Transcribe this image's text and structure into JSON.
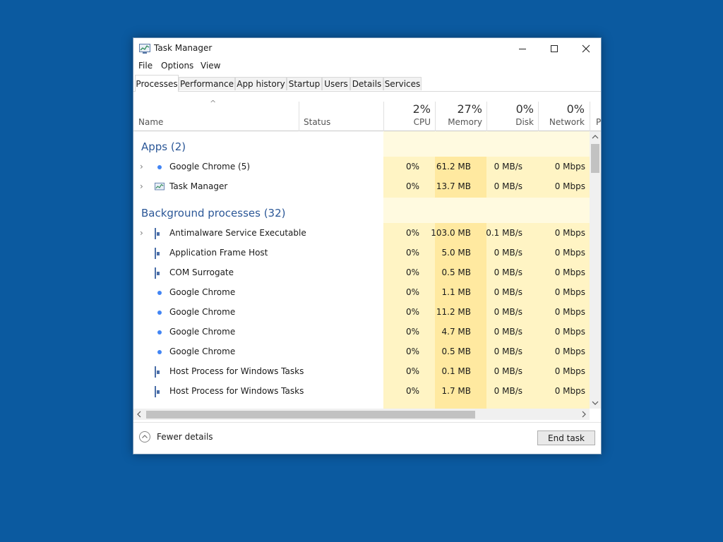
{
  "window": {
    "title": "Task Manager",
    "minimize_glyph": "—",
    "maximize_glyph": "☐",
    "close_glyph": "✕"
  },
  "menu": [
    "File",
    "Options",
    "View"
  ],
  "tabs": [
    "Processes",
    "Performance",
    "App history",
    "Startup",
    "Users",
    "Details",
    "Services"
  ],
  "active_tab": "Processes",
  "columns": {
    "name": "Name",
    "status": "Status",
    "cpu": {
      "pct": "2%",
      "label": "CPU"
    },
    "memory": {
      "pct": "27%",
      "label": "Memory"
    },
    "disk": {
      "pct": "0%",
      "label": "Disk"
    },
    "network": {
      "pct": "0%",
      "label": "Network"
    },
    "cut_column_letter": "P"
  },
  "groups": [
    {
      "title": "Apps (2)"
    },
    {
      "title": "Background processes (32)"
    }
  ],
  "processes": [
    {
      "name": "Google Chrome (5)",
      "icon": "chrome-icon",
      "expandable": true,
      "cpu": "0%",
      "memory": "61.2 MB",
      "disk": "0 MB/s",
      "network": "0 Mbps"
    },
    {
      "name": "Task Manager",
      "icon": "task-manager-icon",
      "expandable": true,
      "cpu": "0%",
      "memory": "13.7 MB",
      "disk": "0 MB/s",
      "network": "0 Mbps"
    },
    {
      "name": "Antimalware Service Executable",
      "icon": "service-window-icon",
      "expandable": true,
      "cpu": "0%",
      "memory": "103.0 MB",
      "disk": "0.1 MB/s",
      "network": "0 Mbps"
    },
    {
      "name": "Application Frame Host",
      "icon": "service-window-icon",
      "expandable": false,
      "cpu": "0%",
      "memory": "5.0 MB",
      "disk": "0 MB/s",
      "network": "0 Mbps"
    },
    {
      "name": "COM Surrogate",
      "icon": "service-window-icon",
      "expandable": false,
      "cpu": "0%",
      "memory": "0.5 MB",
      "disk": "0 MB/s",
      "network": "0 Mbps"
    },
    {
      "name": "Google Chrome",
      "icon": "chrome-icon",
      "expandable": false,
      "cpu": "0%",
      "memory": "1.1 MB",
      "disk": "0 MB/s",
      "network": "0 Mbps"
    },
    {
      "name": "Google Chrome",
      "icon": "chrome-icon",
      "expandable": false,
      "cpu": "0%",
      "memory": "11.2 MB",
      "disk": "0 MB/s",
      "network": "0 Mbps"
    },
    {
      "name": "Google Chrome",
      "icon": "chrome-icon",
      "expandable": false,
      "cpu": "0%",
      "memory": "4.7 MB",
      "disk": "0 MB/s",
      "network": "0 Mbps"
    },
    {
      "name": "Google Chrome",
      "icon": "chrome-icon",
      "expandable": false,
      "cpu": "0%",
      "memory": "0.5 MB",
      "disk": "0 MB/s",
      "network": "0 Mbps"
    },
    {
      "name": "Host Process for Windows Tasks",
      "icon": "service-window-icon",
      "expandable": false,
      "cpu": "0%",
      "memory": "0.1 MB",
      "disk": "0 MB/s",
      "network": "0 Mbps"
    },
    {
      "name": "Host Process for Windows Tasks",
      "icon": "service-window-icon",
      "expandable": false,
      "cpu": "0%",
      "memory": "1.7 MB",
      "disk": "0 MB/s",
      "network": "0 Mbps"
    }
  ],
  "footer": {
    "fewer_details": "Fewer details",
    "end_task": "End task"
  },
  "colors": {
    "desktop": "#0b5aa0",
    "group_title": "#2b5797",
    "heat_light": "#fff4c4",
    "heat_medium": "#ffe9a0"
  },
  "glyphs": {
    "sort_up": "^",
    "expand": "›",
    "fewer": "︿",
    "scroll_up": "︿",
    "scroll_down": "﹀",
    "scroll_left": "‹",
    "scroll_right": "›"
  }
}
